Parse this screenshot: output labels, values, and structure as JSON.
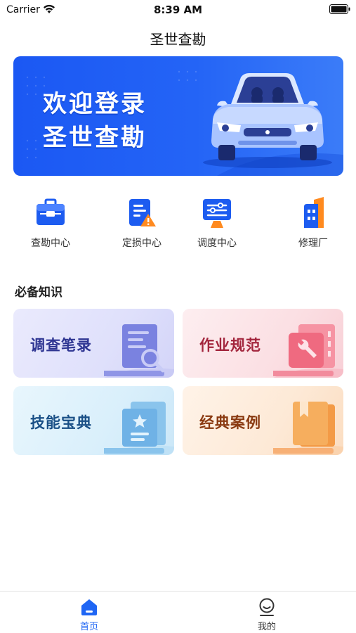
{
  "status_bar": {
    "carrier": "Carrier",
    "time": "8:39 AM",
    "icons": [
      "wifi-icon",
      "battery-icon"
    ]
  },
  "nav": {
    "title": "圣世查勘"
  },
  "banner": {
    "line1": "欢迎登录",
    "line2": "圣世查勘",
    "illustration": "car-illustration",
    "color": "#1b58f3"
  },
  "quick_menu": {
    "items": [
      {
        "label": "查勘中心",
        "icon": "briefcase-icon"
      },
      {
        "label": "定损中心",
        "icon": "document-warning-icon"
      },
      {
        "label": "调度中心",
        "icon": "dispatch-icon"
      },
      {
        "label": "修理厂",
        "icon": "building-icon"
      }
    ]
  },
  "knowledge": {
    "title": "必备知识",
    "cards": [
      {
        "label": "调查笔录",
        "icon": "document-search-icon",
        "color": "#2e3592"
      },
      {
        "label": "作业规范",
        "icon": "toolbox-icon",
        "color": "#a3263d"
      },
      {
        "label": "技能宝典",
        "icon": "star-certificate-icon",
        "color": "#194f86"
      },
      {
        "label": "经典案例",
        "icon": "bookmark-book-icon",
        "color": "#8a3a11"
      }
    ]
  },
  "tab_bar": {
    "active_color": "#1f66f4",
    "tabs": [
      {
        "label": "首页",
        "icon": "home-icon",
        "active": true
      },
      {
        "label": "我的",
        "icon": "profile-icon",
        "active": false
      }
    ]
  }
}
